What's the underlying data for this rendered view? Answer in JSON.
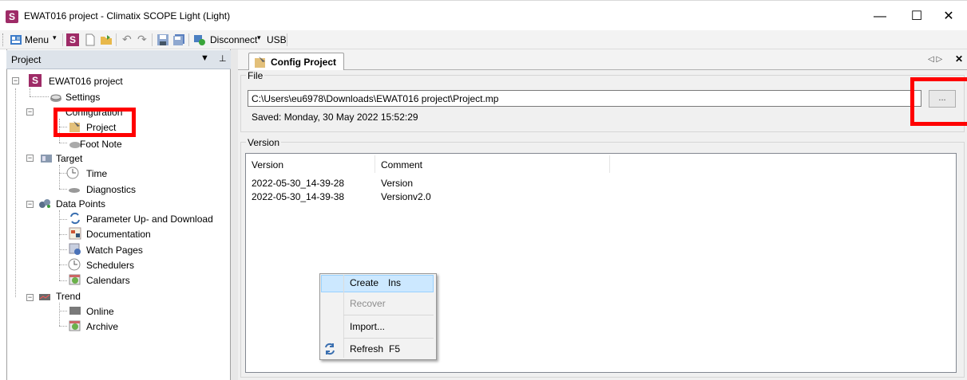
{
  "window": {
    "title": "EWAT016 project - Climatix SCOPE Light (Light)",
    "app_icon_letter": "S",
    "minimize": "—",
    "maximize": "☐",
    "close": "✕"
  },
  "toolbar": {
    "menu_label": "Menu",
    "disconnect_label": "Disconnect",
    "usb_label": "USB"
  },
  "project_panel": {
    "title": "Project",
    "tree": {
      "root": "EWAT016 project",
      "settings": "Settings",
      "configuration": "Configuration",
      "project": "Project",
      "foot_note": "Foot Note",
      "target": "Target",
      "time": "Time",
      "diagnostics": "Diagnostics",
      "data_points": "Data Points",
      "param_updown": "Parameter Up- and Download",
      "documentation": "Documentation",
      "watch_pages": "Watch Pages",
      "schedulers": "Schedulers",
      "calendars": "Calendars",
      "trend": "Trend",
      "online": "Online",
      "archive": "Archive"
    }
  },
  "tab": {
    "label": "Config Project",
    "nav": "◁ ▷",
    "close": "✕"
  },
  "file_group": {
    "title": "File",
    "path": "C:\\Users\\eu6978\\Downloads\\EWAT016 project\\Project.mp",
    "browse_label": "...",
    "saved": "Saved:  Monday, 30 May 2022 15:52:29"
  },
  "version_group": {
    "title": "Version",
    "columns": [
      "Version",
      "Comment"
    ],
    "rows": [
      {
        "version": "2022-05-30_14-39-28",
        "comment": "Version"
      },
      {
        "version": "2022-05-30_14-39-38",
        "comment": "Versionv2.0"
      }
    ]
  },
  "context_menu": {
    "create": "Create",
    "create_shortcut": "Ins",
    "recover": "Recover",
    "import": "Import...",
    "refresh": "Refresh",
    "refresh_shortcut": "F5"
  },
  "colors": {
    "highlight_red": "#ff0000",
    "menu_selection": "#cce8ff",
    "brand": "#9e2b67"
  }
}
